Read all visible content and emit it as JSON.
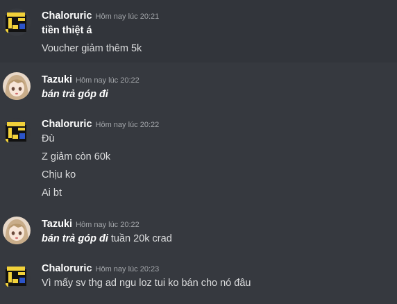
{
  "messages": [
    {
      "author": "Chaloruric",
      "timestamp": "Hôm nay lúc 20:21",
      "avatar": "pixel-robot-icon",
      "lines": [
        {
          "bold": "tiền thiệt á",
          "rest": ""
        },
        {
          "text": "Voucher giảm thêm 5k"
        }
      ]
    },
    {
      "author": "Tazuki",
      "timestamp": "Hôm nay lúc 20:22",
      "avatar": "anime-girl-avatar",
      "lines": [
        {
          "bold_italic": "bán trả góp đi",
          "rest": ""
        }
      ]
    },
    {
      "author": "Chaloruric",
      "timestamp": "Hôm nay lúc 20:22",
      "avatar": "pixel-robot-icon",
      "lines": [
        {
          "text": "Đù"
        },
        {
          "text": "Z giảm còn 60k"
        },
        {
          "text": "Chịu ko"
        },
        {
          "text": "Ai bt"
        }
      ]
    },
    {
      "author": "Tazuki",
      "timestamp": "Hôm nay lúc 20:22",
      "avatar": "anime-girl-avatar",
      "lines": [
        {
          "bold_italic": "bán trả góp đi",
          "rest": " tuần 20k crad"
        }
      ]
    },
    {
      "author": "Chaloruric",
      "timestamp": "Hôm nay lúc 20:23",
      "avatar": "pixel-robot-icon",
      "lines": [
        {
          "text": "Vì mấy sv thg ad ngu loz tui ko bán cho nó đâu"
        }
      ]
    }
  ],
  "colors": {
    "background": "#36393f",
    "hover_background": "#32353b",
    "username": "#ffffff",
    "timestamp": "#a3a6aa",
    "text": "#dcddde"
  }
}
